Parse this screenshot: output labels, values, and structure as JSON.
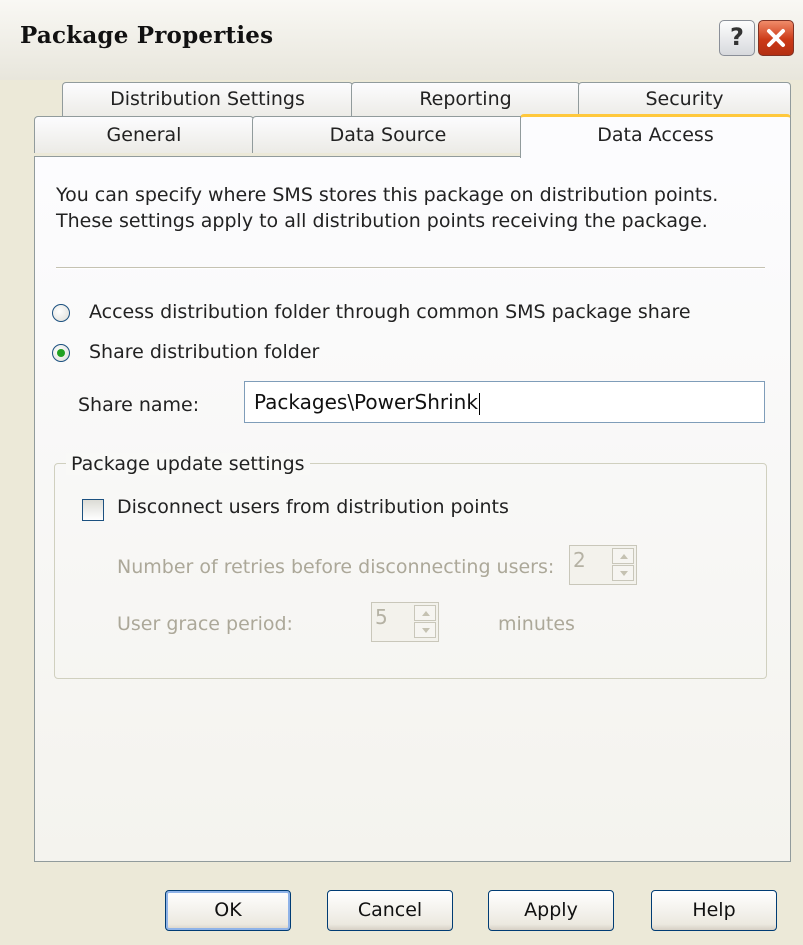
{
  "window": {
    "title": "Package Properties",
    "help_label": "?"
  },
  "tabs": {
    "row1": [
      "Distribution Settings",
      "Reporting",
      "Security"
    ],
    "row2": [
      "General",
      "Data Source",
      "Data Access"
    ],
    "active": "Data Access"
  },
  "data_access": {
    "description_line1": "You can specify where SMS stores this package on distribution points.",
    "description_line2": "These settings apply to all distribution points receiving the package.",
    "radio_common": {
      "label": "Access distribution folder through common SMS package share",
      "selected": false
    },
    "radio_share": {
      "label": "Share distribution folder",
      "selected": true
    },
    "share_name": {
      "label": "Share name:",
      "value": "Packages\\PowerShrink"
    },
    "update_group": {
      "title": "Package update settings",
      "disconnect": {
        "label": "Disconnect users from distribution points",
        "checked": false
      },
      "retries": {
        "label": "Number of retries before disconnecting users:",
        "value": "2"
      },
      "grace": {
        "label": "User grace period:",
        "value": "5",
        "unit": "minutes"
      }
    }
  },
  "buttons": {
    "ok": "OK",
    "cancel": "Cancel",
    "apply": "Apply",
    "help": "Help"
  }
}
